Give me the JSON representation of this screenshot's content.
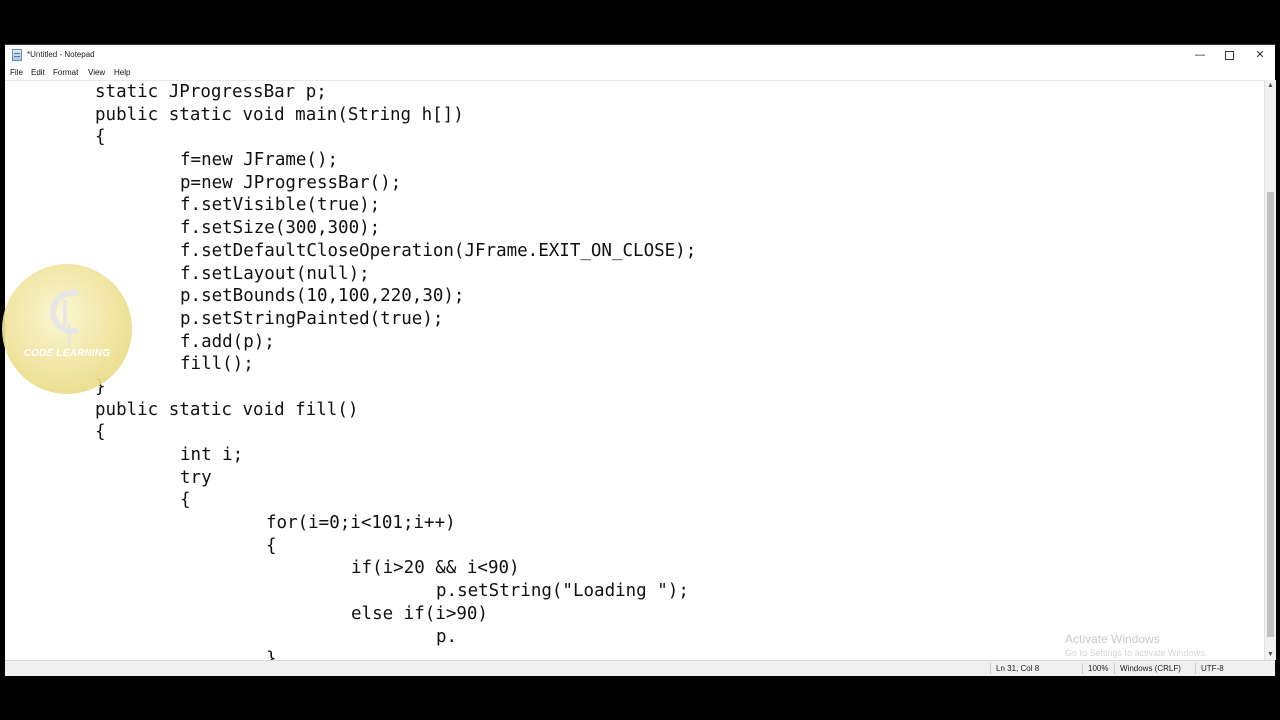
{
  "window": {
    "title": "*Untitled - Notepad"
  },
  "controls": {
    "minimize": "—",
    "close": "✕"
  },
  "menu": [
    {
      "label": "File"
    },
    {
      "label": "Edit"
    },
    {
      "label": "Format"
    },
    {
      "label": "View"
    },
    {
      "label": "Help"
    }
  ],
  "editor": {
    "lines": [
      {
        "indent": 0,
        "text": "static JProgressBar p;"
      },
      {
        "indent": 0,
        "text": "public static void main(String h[])"
      },
      {
        "indent": 0,
        "text": "{"
      },
      {
        "indent": 1,
        "text": "f=new JFrame();"
      },
      {
        "indent": 1,
        "text": "p=new JProgressBar();"
      },
      {
        "indent": 1,
        "text": "f.setVisible(true);"
      },
      {
        "indent": 1,
        "text": "f.setSize(300,300);"
      },
      {
        "indent": 1,
        "text": "f.setDefaultCloseOperation(JFrame.EXIT_ON_CLOSE);"
      },
      {
        "indent": 1,
        "text": "f.setLayout(null);"
      },
      {
        "indent": 1,
        "text": "p.setBounds(10,100,220,30);"
      },
      {
        "indent": 1,
        "text": "p.setStringPainted(true);"
      },
      {
        "indent": 1,
        "text": "f.add(p);"
      },
      {
        "indent": 1,
        "text": "fill();"
      },
      {
        "indent": 0,
        "text": "}"
      },
      {
        "indent": 0,
        "text": "public static void fill()"
      },
      {
        "indent": 0,
        "text": "{"
      },
      {
        "indent": 1,
        "text": "int i;"
      },
      {
        "indent": 1,
        "text": "try"
      },
      {
        "indent": 1,
        "text": "{"
      },
      {
        "indent": 2,
        "text": "for(i=0;i<101;i++)"
      },
      {
        "indent": 2,
        "text": "{"
      },
      {
        "indent": 3,
        "text": "if(i>20 && i<90)"
      },
      {
        "indent": 4,
        "text": "p.setString(\"Loading \");"
      },
      {
        "indent": 3,
        "text": "else if(i>90)"
      },
      {
        "indent": 4,
        "text": "p."
      },
      {
        "indent": 2,
        "text": "}"
      }
    ]
  },
  "status": {
    "position": "Ln 31, Col 8",
    "zoom": "100%",
    "line_endings": "Windows (CRLF)",
    "encoding": "UTF-8"
  },
  "activation": {
    "title": "Activate Windows",
    "subtitle": "Go to Settings to activate Windows."
  },
  "watermark": {
    "text": "CODE LEARNING"
  },
  "colors": {
    "titlebar": "#ffffff",
    "statusbar": "#f0f0f0",
    "watermark": "#efe39a"
  }
}
